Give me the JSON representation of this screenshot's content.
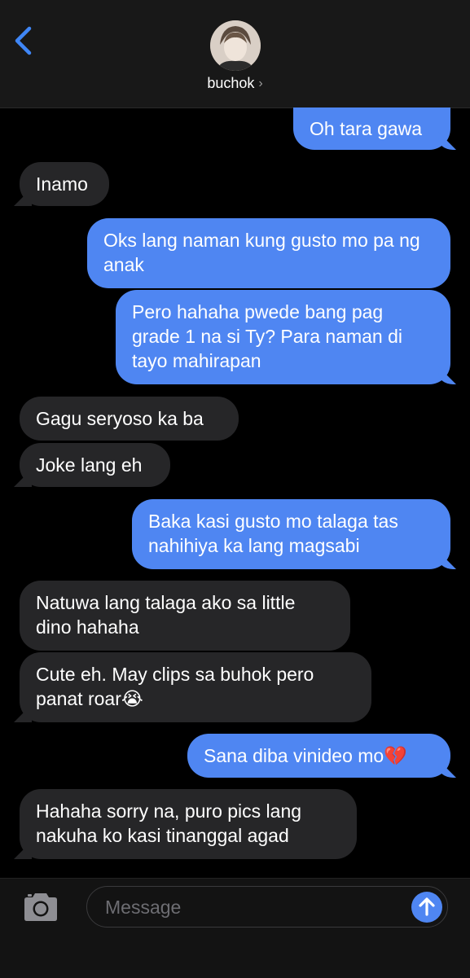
{
  "header": {
    "contact_name": "buchok",
    "chevron": "›"
  },
  "messages": [
    {
      "direction": "outgoing",
      "text": "Oh tara gawa"
    },
    {
      "direction": "incoming",
      "text": "Inamo"
    },
    {
      "direction": "outgoing",
      "text": "Oks lang naman kung gusto mo pa ng anak"
    },
    {
      "direction": "outgoing",
      "text": "Pero hahaha pwede bang pag grade 1 na si Ty? Para naman di tayo mahirapan"
    },
    {
      "direction": "incoming",
      "text": "Gagu seryoso ka ba"
    },
    {
      "direction": "incoming",
      "text": "Joke lang eh"
    },
    {
      "direction": "outgoing",
      "text": "Baka kasi gusto mo talaga tas nahihiya ka lang magsabi"
    },
    {
      "direction": "incoming",
      "text": "Natuwa lang talaga ako sa little dino hahaha"
    },
    {
      "direction": "incoming",
      "text": "Cute eh. May clips sa buhok pero panat roar😭"
    },
    {
      "direction": "outgoing",
      "text": "Sana diba vinideo mo💔"
    },
    {
      "direction": "incoming",
      "text": "Hahaha sorry na, puro pics lang nakuha ko kasi tinanggal agad"
    }
  ],
  "composer": {
    "placeholder": "Message"
  },
  "colors": {
    "outgoing_bubble": "#4f86f2",
    "incoming_bubble": "#262628",
    "accent": "#4f86f2",
    "background": "#000000"
  },
  "icons": {
    "back": "chevron-left-icon",
    "camera": "camera-icon",
    "send": "arrow-up-icon"
  }
}
